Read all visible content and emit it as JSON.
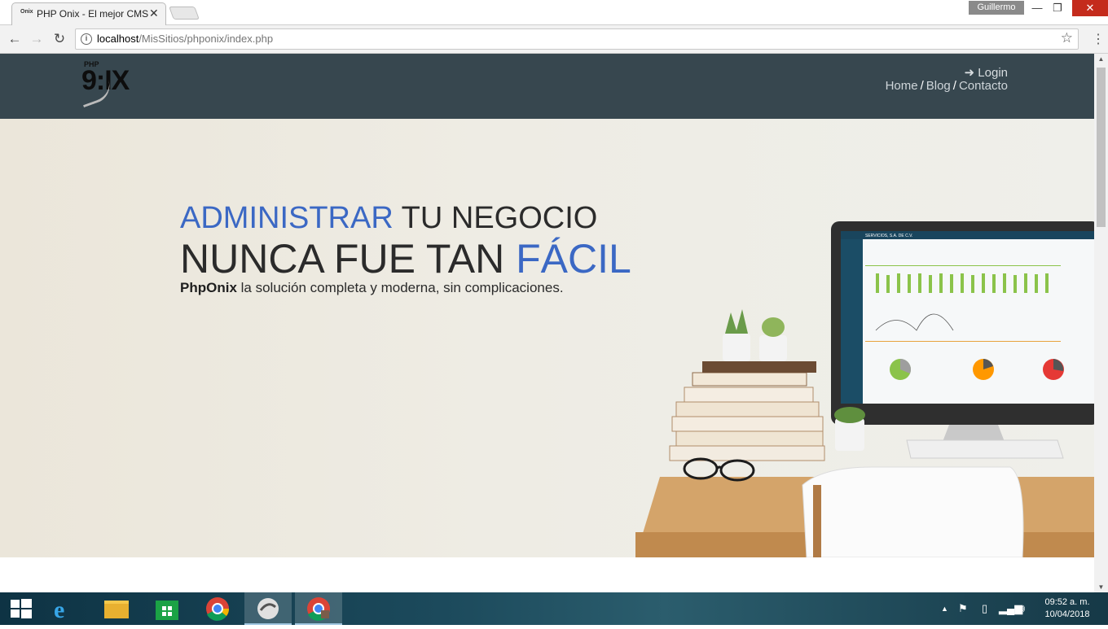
{
  "browser": {
    "tab_title": "PHP Onix - El mejor CMS",
    "tab_favicon": "Onix",
    "profile_name": "Guillermo",
    "url_host": "localhost",
    "url_path": "/MisSitios/phponix/index.php"
  },
  "site": {
    "logo_small": "PHP",
    "logo_main": "9:IX",
    "nav": {
      "login": "Login",
      "home": "Home",
      "blog": "Blog",
      "contacto": "Contacto",
      "separator": "/"
    },
    "hero": {
      "line1_accent": "ADMINISTRAR",
      "line1_rest": " TU NEGOCIO",
      "line2_rest": "NUNCA FUE TAN ",
      "line2_accent": "FÁCIL",
      "sub_brand": "PhpOnix",
      "sub_rest": " la solución completa y moderna, sin complicaciones."
    },
    "mockup": {
      "company": "SERVICIOS, S.A. DE C.V."
    }
  },
  "taskbar": {
    "time": "09:52 a. m.",
    "date": "10/04/2018"
  },
  "colors": {
    "navbar": "#37474f",
    "accent": "#3b68c4"
  }
}
